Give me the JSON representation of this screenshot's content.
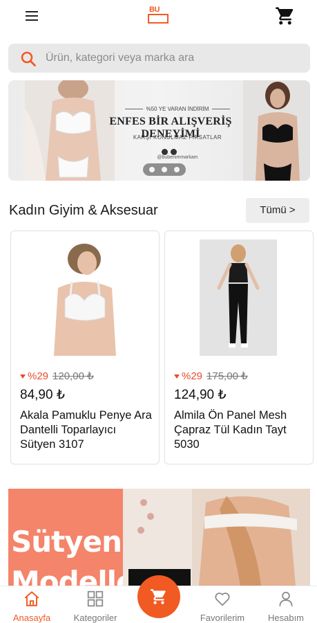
{
  "header": {
    "menu_icon": "hamburger-menu-icon",
    "logo_text": "BU",
    "cart_icon": "shopping-cart-icon"
  },
  "search": {
    "placeholder": "Ürün, kategori veya marka ara",
    "icon": "search-icon"
  },
  "banner": {
    "subtitle": "%50 YE VARAN İNDİRİM",
    "title": "ENFES BİR ALIŞVERİŞ DENEYİMİ",
    "tagline": "KARŞI KONULMAZ FIRSATLAR",
    "handle": "@bubenimmarkam",
    "slides_total": 3,
    "slide_active": 1
  },
  "section": {
    "title": "Kadın Giyim & Aksesuar",
    "see_all_label": "Tümü >"
  },
  "products": [
    {
      "discount": "%29",
      "old_price": "120,00 ₺",
      "price": "84,90 ₺",
      "name": "Akala Pamuklu Penye Ara Dantelli Toparlayıcı Sütyen 3107"
    },
    {
      "discount": "%29",
      "old_price": "175,00 ₺",
      "price": "124,90 ₺",
      "name": "Almila Ön Panel Mesh Çapraz Tül Kadın Tayt 5030"
    }
  ],
  "category_banner": {
    "line1": "Sütyen",
    "line2": "Modelleri"
  },
  "bottom_nav": {
    "items": [
      {
        "label": "Anasayfa",
        "icon": "home-icon",
        "active": true
      },
      {
        "label": "Kategoriler",
        "icon": "grid-icon",
        "active": false
      },
      {
        "label": "Favorilerim",
        "icon": "heart-icon",
        "active": false
      },
      {
        "label": "Hesabım",
        "icon": "user-icon",
        "active": false
      }
    ],
    "center_icon": "cart-icon"
  },
  "colors": {
    "accent": "#f15a22",
    "discount": "#e84b2b",
    "search_bg": "#e8e8e8"
  }
}
